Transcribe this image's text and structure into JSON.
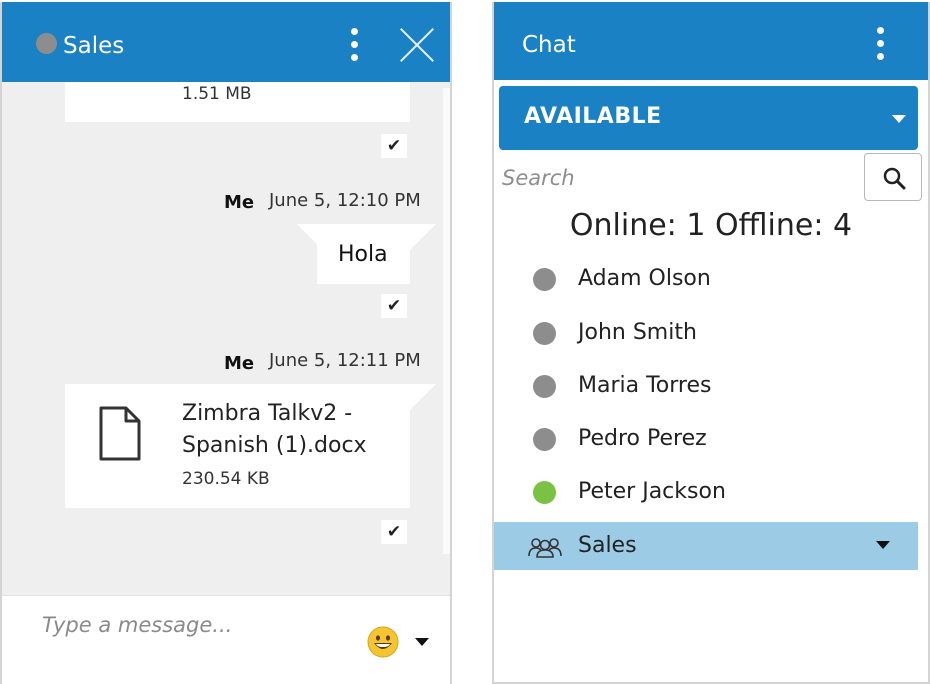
{
  "conversation": {
    "title": "Sales",
    "first_file": {
      "size": "1.51 MB"
    },
    "messages": [
      {
        "sender": "Me",
        "time": "June 5, 12:10 PM",
        "text": "Hola"
      },
      {
        "sender": "Me",
        "time": "June 5, 12:11 PM",
        "file_name": "Zimbra Talkv2 - Spanish (1).docx",
        "file_size": "230.54 KB"
      }
    ],
    "composer": {
      "placeholder": "Type a message..."
    }
  },
  "chat_panel": {
    "title": "Chat",
    "status": "AVAILABLE",
    "search": {
      "placeholder": "Search"
    },
    "counts": "Online: 1 Offline: 4",
    "contacts": [
      {
        "name": "Adam Olson",
        "status": "offline"
      },
      {
        "name": "John Smith",
        "status": "offline"
      },
      {
        "name": "Maria Torres",
        "status": "offline"
      },
      {
        "name": "Pedro Perez",
        "status": "offline"
      },
      {
        "name": "Peter Jackson",
        "status": "online"
      }
    ],
    "group": {
      "name": "Sales"
    }
  },
  "colors": {
    "header_blue": "#1a82c4",
    "selected_row": "#9ccbe6",
    "online_green": "#7bc144",
    "offline_gray": "#8d8d8d"
  },
  "icons": [
    "more-vertical-icon",
    "close-icon",
    "file-icon",
    "check-icon",
    "emoji-icon",
    "search-icon",
    "group-icon",
    "chevron-down-icon"
  ]
}
